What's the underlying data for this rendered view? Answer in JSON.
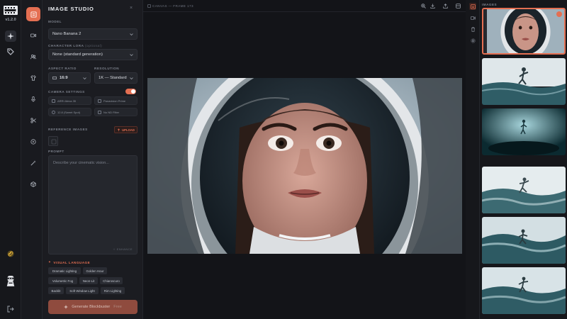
{
  "app": {
    "version": "v1.2.0",
    "logo_icon": "film-reel-icon",
    "accent_color": "#e46f52"
  },
  "rail": {
    "items": [
      {
        "icon": "sparkles-icon",
        "active": true
      },
      {
        "icon": "tag-icon",
        "active": false
      },
      {
        "icon": "link-chain-icon",
        "active": false
      },
      {
        "icon": "ninja-avatar-icon",
        "active": false
      },
      {
        "icon": "logout-icon",
        "active": false
      }
    ]
  },
  "tools": {
    "items": [
      "image-studio-icon",
      "video-camera-icon",
      "users-icon",
      "shirt-icon",
      "mic-icon",
      "scissors-icon",
      "play-circle-icon",
      "magic-wand-icon",
      "cube-icon"
    ]
  },
  "panel": {
    "title": "IMAGE STUDIO",
    "close_label": "×",
    "model": {
      "label": "MODEL",
      "value": "Nano Banana 2"
    },
    "character_lora": {
      "label": "CHARACTER LORA",
      "optional": "(optional)",
      "value": "None (standard generation)"
    },
    "aspect_ratio": {
      "label": "ASPECT RATIO",
      "value": "16:9"
    },
    "resolution": {
      "label": "RESOLUTION",
      "value": "1K — Standard"
    },
    "camera_settings": {
      "label": "CAMERA SETTINGS",
      "enabled": true,
      "camera": "ARRI Alexa 35",
      "lens": "Panavision Prime",
      "focal": "12.8 (Sweet Spot)",
      "filter": "No ND Filter"
    },
    "reference_images": {
      "label": "REFERENCE IMAGES",
      "upload_label": "UPLOAD"
    },
    "prompt": {
      "label": "PROMPT",
      "placeholder": "Describe your cinematic vision...",
      "enhance_label": "ENHANCE"
    },
    "visual_language": {
      "label": "VISUAL LANGUAGE",
      "chips": [
        "Dramatic Lighting",
        "Golden Hour",
        "Volumetric Fog",
        "Neon-Lit",
        "Chiaroscuro",
        "Backlit",
        "Soft Window Light",
        "Rim Lighting"
      ]
    },
    "generate": {
      "label": "Generate Blockbuster",
      "tag": "Free"
    }
  },
  "canvas": {
    "breadcrumb": "CANVAS — FRAME 173",
    "toolbar": [
      "zoom-in-icon",
      "download-icon",
      "share-icon",
      "layout-icon"
    ],
    "image_description_icon": "astronaut-portrait-image"
  },
  "gallery": {
    "title": "IMAGES",
    "rail": [
      "images-icon",
      "video-icon",
      "trash-icon",
      "gear-icon"
    ],
    "thumbs": [
      {
        "name": "astronaut-portrait",
        "selected": true
      },
      {
        "name": "underwater-swimmer-1",
        "selected": false
      },
      {
        "name": "underwater-swimmer-2",
        "selected": false
      },
      {
        "name": "underwater-swimmer-3",
        "selected": false
      },
      {
        "name": "underwater-swimmer-4",
        "selected": false
      },
      {
        "name": "underwater-swimmer-5",
        "selected": false
      }
    ]
  }
}
